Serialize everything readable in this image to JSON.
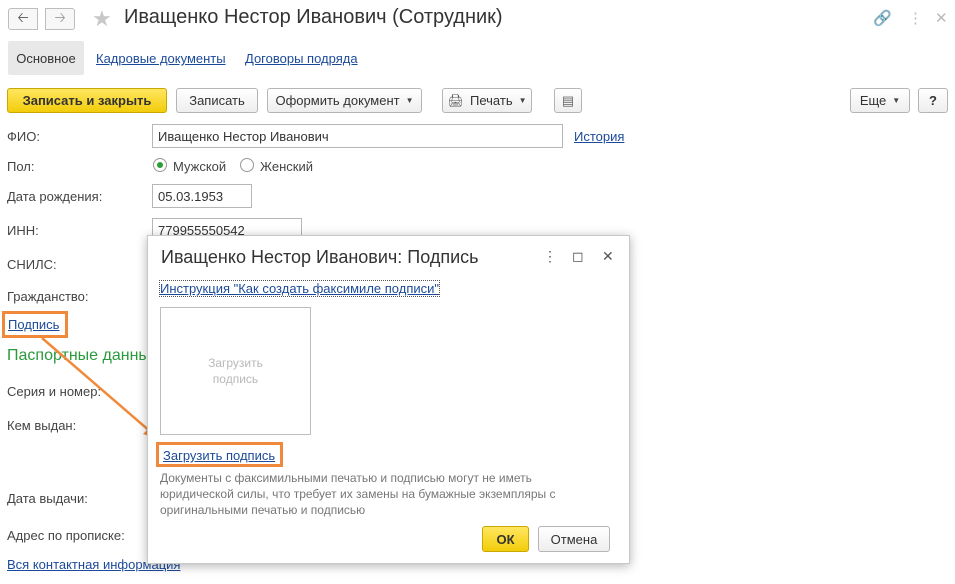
{
  "window": {
    "title": "Иващенко Нестор Иванович (Сотрудник)"
  },
  "tabs": [
    {
      "label": "Основное"
    },
    {
      "label": "Кадровые документы"
    },
    {
      "label": "Договоры подряда"
    }
  ],
  "toolbar": {
    "save_close": "Записать и закрыть",
    "save": "Записать",
    "create_doc": "Оформить документ",
    "print": "Печать",
    "more": "Еще",
    "help": "?"
  },
  "form": {
    "fio_label": "ФИО:",
    "fio_value": "Иващенко Нестор Иванович",
    "history_link": "История",
    "gender_label": "Пол:",
    "gender_male": "Мужской",
    "gender_female": "Женский",
    "birth_label": "Дата рождения:",
    "birth_value": "05.03.1953",
    "inn_label": "ИНН:",
    "inn_value": "779955550542",
    "snils_label": "СНИЛС:",
    "citizenship_label": "Гражданство:",
    "signature_link": "Подпись",
    "passport_section": "Паспортные данны",
    "series_label": "Серия и номер:",
    "issued_by_label": "Кем выдан:",
    "issue_date_label": "Дата выдачи:",
    "address_label": "Адрес по прописке:",
    "contact_link": "Вся контактная информация"
  },
  "dialog": {
    "title": "Иващенко Нестор Иванович: Подпись",
    "instruction_link": "Инструкция \"Как создать факсимиле подписи\"",
    "sig_placeholder_line1": "Загрузить",
    "sig_placeholder_line2": "подпись",
    "upload_link": "Загрузить подпись",
    "note": "Документы с факсимильными печатью и подписью могут не иметь юридической силы, что требует их замены на бумажные экземпляры с оригинальными печатью и подписью",
    "ok": "ОК",
    "cancel": "Отмена"
  },
  "colors": {
    "primary_button": "#f2cd0a",
    "link": "#1c4a9a",
    "section_title": "#2a9a3c",
    "highlight": "#f08a3a"
  },
  "icons": [
    "arrow-left-icon",
    "arrow-right-icon",
    "star-icon",
    "link-icon",
    "more-vert-icon",
    "close-icon",
    "printer-icon",
    "list-icon",
    "maximize-icon"
  ]
}
